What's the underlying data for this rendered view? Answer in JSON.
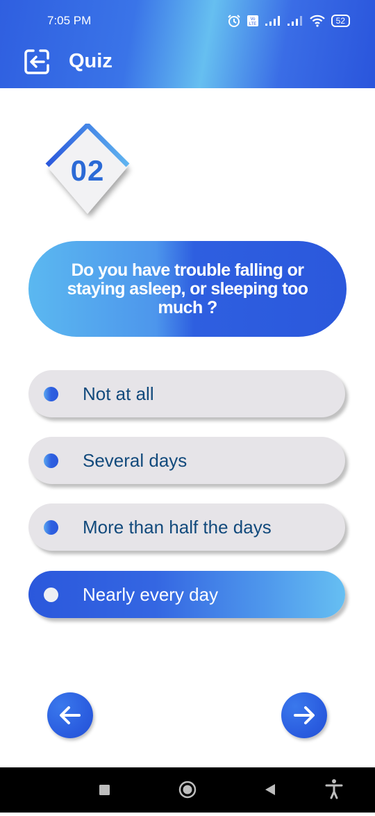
{
  "status_bar": {
    "time": "7:05 PM",
    "battery": "52",
    "icons": [
      "alarm-icon",
      "volte-icon",
      "signal-icon",
      "signal-icon",
      "wifi-icon",
      "battery-icon"
    ]
  },
  "header": {
    "title": "Quiz",
    "back_icon": "exit-icon"
  },
  "quiz": {
    "question_number": "02",
    "question": "Do you have trouble falling or staying asleep, or sleeping too much ?",
    "options": [
      {
        "label": "Not at all",
        "selected": false
      },
      {
        "label": "Several days",
        "selected": false
      },
      {
        "label": "More than half the days",
        "selected": false
      },
      {
        "label": "Nearly every day",
        "selected": true
      }
    ]
  },
  "navigation": {
    "prev_icon": "arrow-left-icon",
    "next_icon": "arrow-right-icon"
  },
  "system_nav": {
    "icons": [
      "recents-icon",
      "home-icon",
      "back-triangle-icon",
      "accessibility-icon"
    ]
  },
  "colors": {
    "primary": "#2b58dc",
    "accent_light": "#66bff2",
    "option_bg": "#e6e4e8",
    "option_text": "#124a7c",
    "badge_text": "#2b6ad6"
  }
}
